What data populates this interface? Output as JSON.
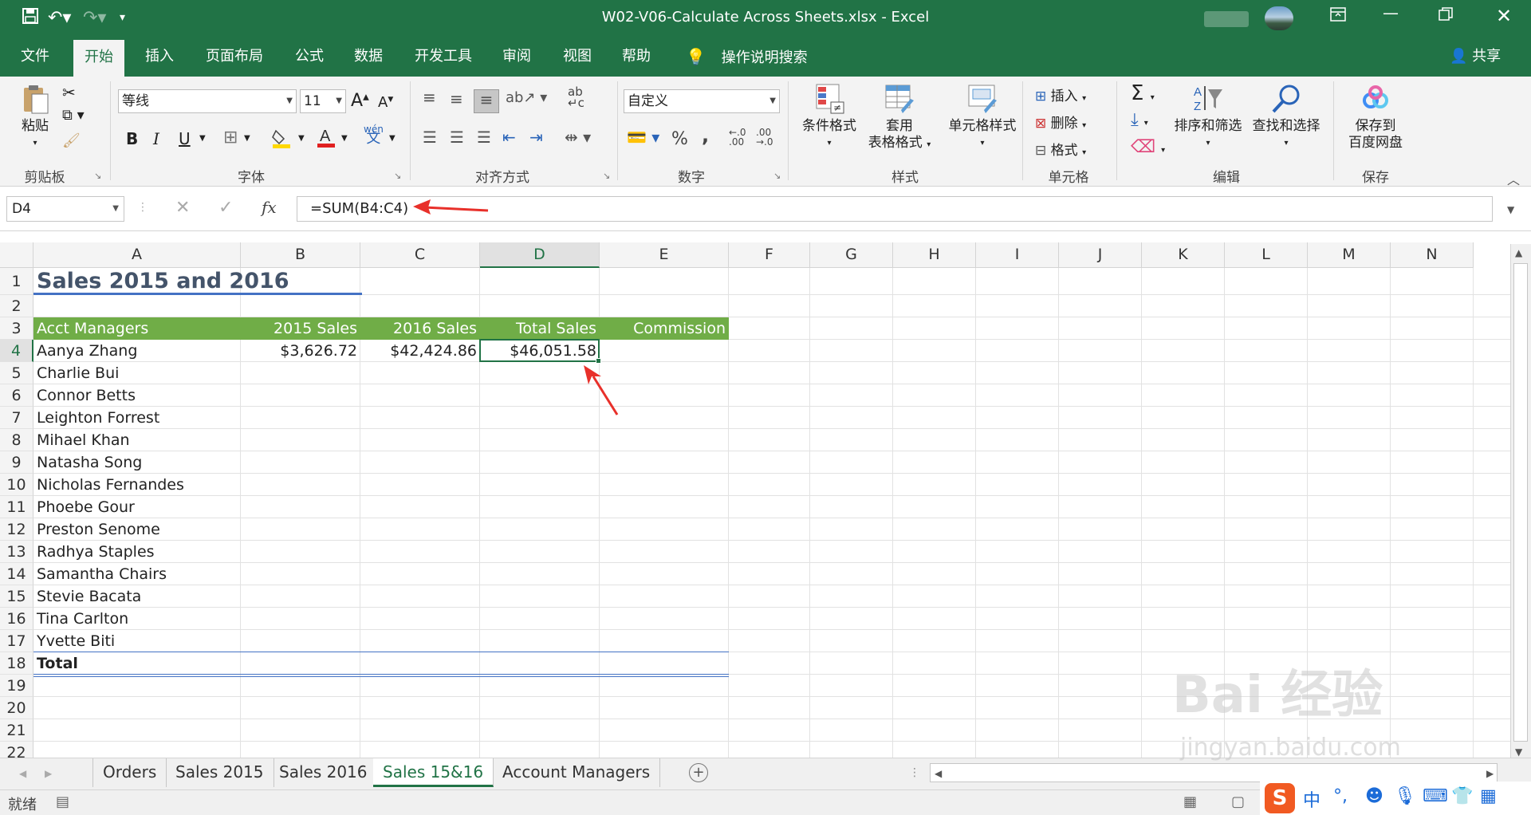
{
  "window": {
    "title": "W02-V06-Calculate Across Sheets.xlsx  -  Excel",
    "controls": [
      "restore-ribbon",
      "minimize",
      "maximize",
      "close"
    ]
  },
  "ribbon_tabs": [
    "文件",
    "开始",
    "插入",
    "页面布局",
    "公式",
    "数据",
    "开发工具",
    "审阅",
    "视图",
    "帮助"
  ],
  "active_tab": "开始",
  "tell_me": "操作说明搜索",
  "share": "共享",
  "ribbon": {
    "clipboard": {
      "paste": "粘贴",
      "label": "剪贴板"
    },
    "font": {
      "name": "等线",
      "size": "11",
      "label": "字体",
      "bold": "B",
      "italic": "I",
      "underline": "U",
      "grow": "A",
      "shrink": "A",
      "phonetic": "wén"
    },
    "alignment": {
      "label": "对齐方式"
    },
    "number": {
      "format": "自定义",
      "label": "数字",
      "percent": "%",
      "comma": ","
    },
    "styles": {
      "conditional": "条件格式",
      "table_line1": "套用",
      "table_line2": "表格格式",
      "cell_styles": "单元格样式",
      "label": "样式"
    },
    "cells": {
      "insert": "插入",
      "delete": "删除",
      "format": "格式",
      "label": "单元格"
    },
    "editing": {
      "sort": "排序和筛选",
      "find": "查找和选择",
      "label": "编辑"
    },
    "save": {
      "line1": "保存到",
      "line2": "百度网盘",
      "label": "保存"
    }
  },
  "formula_bar": {
    "name_box": "D4",
    "formula": "=SUM(B4:C4)"
  },
  "columns": [
    "A",
    "B",
    "C",
    "D",
    "E",
    "F",
    "G",
    "H",
    "I",
    "J",
    "K",
    "L",
    "M",
    "N"
  ],
  "selected_column": "D",
  "rows": [
    "1",
    "2",
    "3",
    "4",
    "5",
    "6",
    "7",
    "8",
    "9",
    "10",
    "11",
    "12",
    "13",
    "14",
    "15",
    "16",
    "17",
    "18",
    "19",
    "20",
    "21",
    "22"
  ],
  "selected_row": "4",
  "sheet": {
    "title": "Sales 2015 and 2016",
    "headers": [
      "Acct Managers",
      "2015 Sales",
      "2016 Sales",
      "Total Sales",
      "Commission"
    ],
    "data_rows": [
      [
        "Aanya Zhang",
        "$3,626.72",
        "$42,424.86",
        "$46,051.58",
        ""
      ],
      [
        "Charlie Bui",
        "",
        "",
        "",
        ""
      ],
      [
        "Connor Betts",
        "",
        "",
        "",
        ""
      ],
      [
        "Leighton Forrest",
        "",
        "",
        "",
        ""
      ],
      [
        "Mihael Khan",
        "",
        "",
        "",
        ""
      ],
      [
        "Natasha Song",
        "",
        "",
        "",
        ""
      ],
      [
        "Nicholas Fernandes",
        "",
        "",
        "",
        ""
      ],
      [
        "Phoebe Gour",
        "",
        "",
        "",
        ""
      ],
      [
        "Preston Senome",
        "",
        "",
        "",
        ""
      ],
      [
        "Radhya Staples",
        "",
        "",
        "",
        ""
      ],
      [
        "Samantha Chairs",
        "",
        "",
        "",
        ""
      ],
      [
        "Stevie Bacata",
        "",
        "",
        "",
        ""
      ],
      [
        "Tina Carlton",
        "",
        "",
        "",
        ""
      ],
      [
        "Yvette Biti",
        "",
        "",
        "",
        ""
      ]
    ],
    "total_label": "Total"
  },
  "sheet_tabs": [
    "Orders",
    "Sales 2015",
    "Sales 2016",
    "Sales 15&16",
    "Account Managers"
  ],
  "active_sheet": "Sales 15&16",
  "status": "就绪",
  "ime": {
    "logo": "S",
    "lang": "中",
    "punct": "°,"
  },
  "watermark": {
    "brand": "Bai 经验",
    "url": "jingyan.baidu.com"
  },
  "colors": {
    "excel_green": "#217346",
    "header_band": "#70ad47",
    "title_text": "#44546a",
    "accent_blue": "#4472c4",
    "annotation_red": "#e8302a"
  }
}
